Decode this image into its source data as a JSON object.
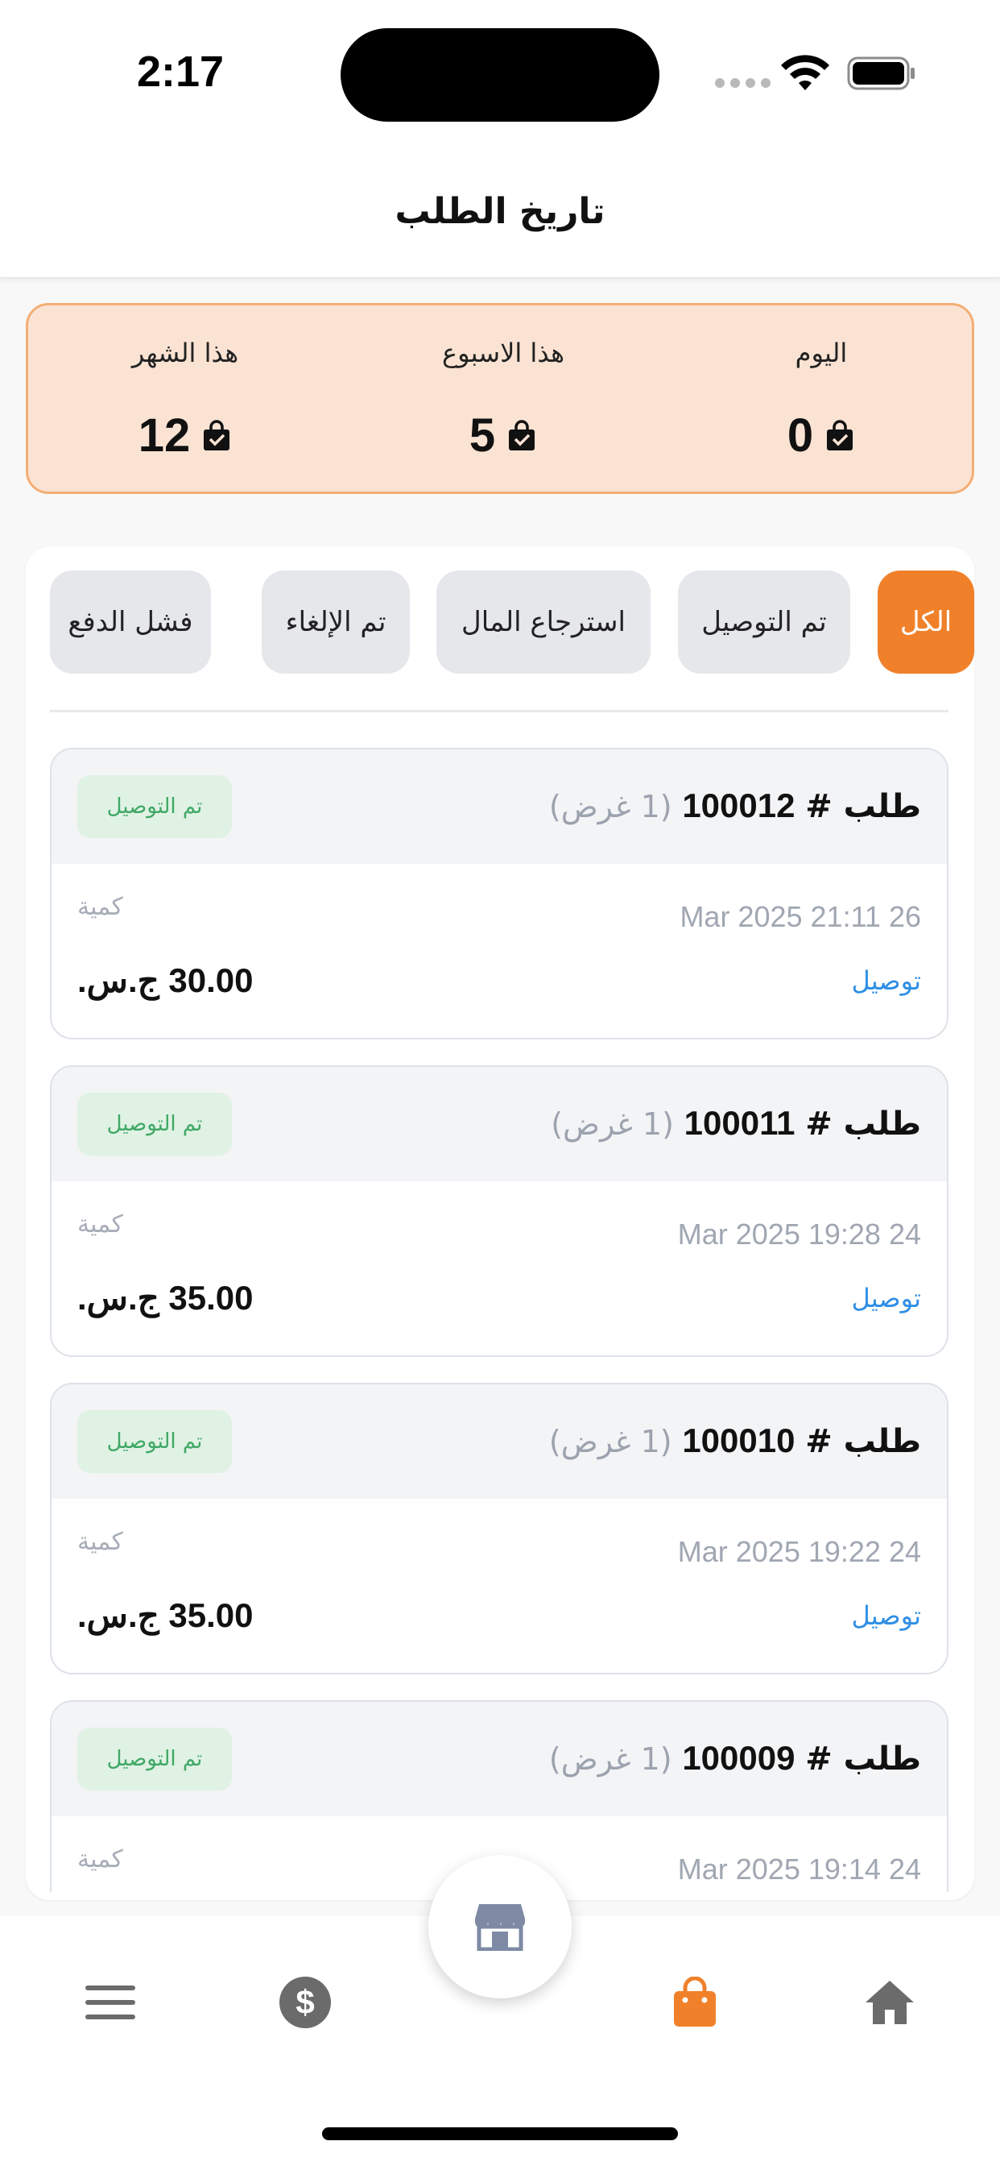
{
  "status_bar": {
    "time": "2:17"
  },
  "header": {
    "title": "تاريخ الطلب"
  },
  "stats": [
    {
      "label": "اليوم",
      "value": "0",
      "icon": "shopping-bag-check-icon"
    },
    {
      "label": "هذا الاسبوع",
      "value": "5",
      "icon": "shopping-bag-check-icon"
    },
    {
      "label": "هذا الشهر",
      "value": "12",
      "icon": "shopping-bag-check-icon"
    }
  ],
  "filters": [
    {
      "label": "الكل",
      "active": true
    },
    {
      "label": "تم التوصيل",
      "active": false
    },
    {
      "label": "استرجاع المال",
      "active": false
    },
    {
      "label": "تم الإلغاء",
      "active": false
    },
    {
      "label": "فشل الدفع",
      "active": false
    }
  ],
  "orders": [
    {
      "label": "طلب #",
      "number": "100012",
      "offers": "(1 غرض)",
      "status": "تم التوصيل",
      "date": "Mar 2025  21:11 26",
      "qty_label": "كمية",
      "method": "توصيل",
      "total": "30.00 ج.س."
    },
    {
      "label": "طلب #",
      "number": "100011",
      "offers": "(1 غرض)",
      "status": "تم التوصيل",
      "date": "Mar 2025  19:28 24",
      "qty_label": "كمية",
      "method": "توصيل",
      "total": "35.00 ج.س."
    },
    {
      "label": "طلب #",
      "number": "100010",
      "offers": "(1 غرض)",
      "status": "تم التوصيل",
      "date": "Mar 2025  19:22 24",
      "qty_label": "كمية",
      "method": "توصيل",
      "total": "35.00 ج.س."
    },
    {
      "label": "طلب #",
      "number": "100009",
      "offers": "(1 غرض)",
      "status": "تم التوصيل",
      "date": "Mar 2025  19:14 24",
      "qty_label": "كمية",
      "method": "",
      "total": ""
    }
  ],
  "tab_bar": {
    "tabs": [
      "home-icon",
      "shopping-bag-icon",
      "dollar-icon",
      "menu-icon"
    ],
    "active": "shopping-bag-icon",
    "center": "store-icon"
  },
  "colors": {
    "accent": "#f0812a",
    "delivered_bg": "#dff2e4",
    "delivered_text": "#3fa865",
    "link": "#2f8fe6",
    "stats_bg": "#fae3d3"
  }
}
